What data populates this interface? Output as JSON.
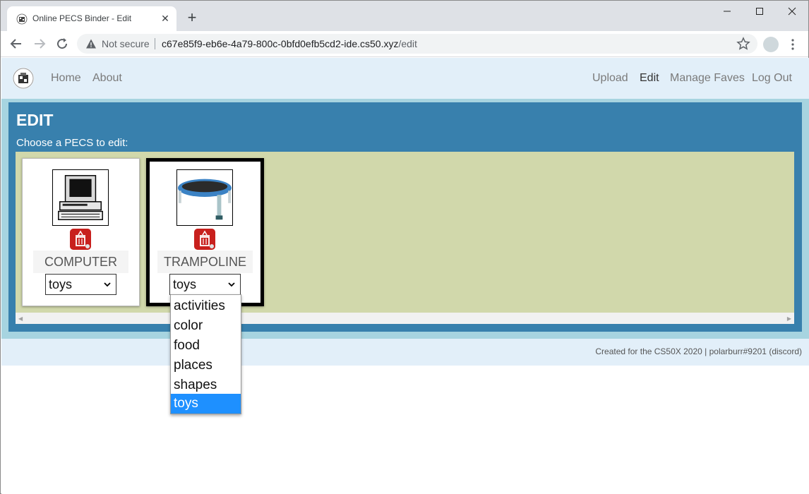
{
  "browser": {
    "tab_title": "Online PECS Binder - Edit",
    "tab_close": "✕",
    "new_tab": "+",
    "security": "Not secure",
    "url_host": "c67e85f9-eb6e-4a79-800c-0bfd0efb5cd2-ide.cs50.xyz",
    "url_path": "/edit"
  },
  "nav": {
    "home": "Home",
    "about": "About",
    "upload": "Upload",
    "edit": "Edit",
    "manage_faves": "Manage Faves",
    "logout": "Log Out"
  },
  "main": {
    "title": "EDIT",
    "subtitle": "Choose a PECS to edit:",
    "cards": [
      {
        "label": "COMPUTER",
        "category": "toys",
        "selected": false,
        "image": "computer-image"
      },
      {
        "label": "TRAMPOLINE",
        "category": "toys",
        "selected": true,
        "image": "trampoline-image"
      }
    ]
  },
  "dropdown": {
    "options": [
      "activities",
      "color",
      "food",
      "places",
      "shapes",
      "toys"
    ],
    "selected": "toys"
  },
  "footer": {
    "text": "Created for the CS50X 2020 | polarburr#9201 (discord)"
  },
  "colors": {
    "navbar": "#e2eff9",
    "panel": "#3880ad",
    "gallery": "#d1d8ab",
    "selected_option": "#1e90ff"
  }
}
